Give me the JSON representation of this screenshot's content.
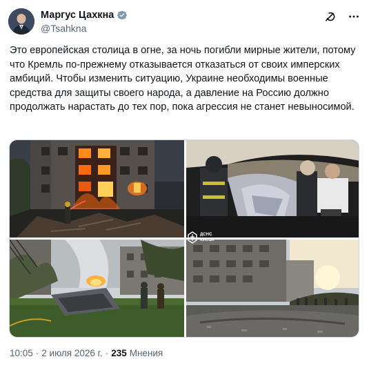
{
  "author": {
    "display_name": "Маргус Цахкна",
    "handle": "@Tsahkna",
    "verified": true
  },
  "icons": {
    "verified": "verified-badge-icon",
    "grok": "grok-icon",
    "more": "more-icon",
    "watermark": "dsns-emblem-icon"
  },
  "colors": {
    "verified_badge": "#829aab",
    "secondary_text": "#536471",
    "primary_text": "#0f1419"
  },
  "post": {
    "text": "Это европейская столица в огне, за ночь погибли мирные жители, потому что Кремль по-прежнему отказывается отказаться от своих имперских амбиций. Чтобы изменить ситуацию, Украине необходимы военные средства для защиты своего народа, а давление на Россию должно продолжать нарастать до тех пор, пока агрессия не станет невыносимой."
  },
  "media": {
    "watermark_line1": "ДСНС",
    "watermark_line2": "КИЄВА"
  },
  "meta": {
    "time": "10:05",
    "separator": "·",
    "date": "2 июля 2026 г.",
    "views_count": "235",
    "views_label": "Мнения"
  }
}
